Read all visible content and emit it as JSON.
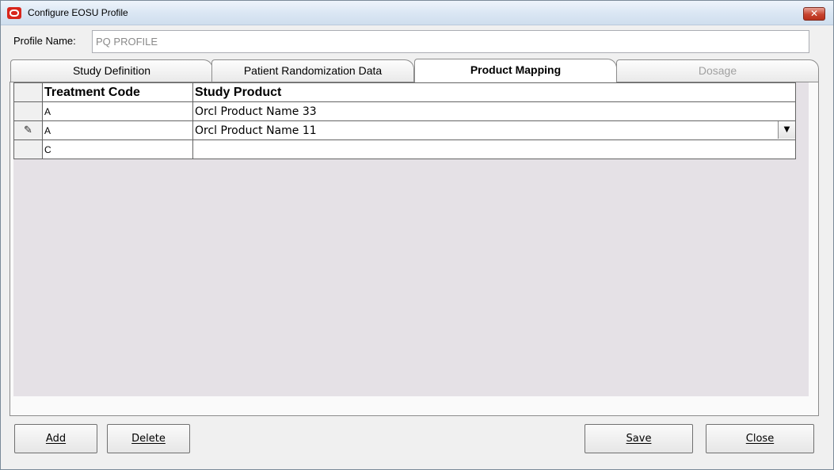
{
  "window": {
    "title": "Configure EOSU Profile",
    "close_glyph": "✕"
  },
  "profile": {
    "label": "Profile Name:",
    "value": "PQ PROFILE"
  },
  "tabs": [
    {
      "label": "Study Definition",
      "state": "normal"
    },
    {
      "label": "Patient Randomization Data",
      "state": "normal"
    },
    {
      "label": "Product Mapping",
      "state": "active"
    },
    {
      "label": "Dosage",
      "state": "disabled"
    }
  ],
  "grid": {
    "columns": [
      "Treatment Code",
      "Study Product"
    ],
    "rows": [
      {
        "treatment_code": "A",
        "study_product": "Orcl Product Name 33",
        "editing": false
      },
      {
        "treatment_code": "A",
        "study_product": "Orcl Product Name 11",
        "editing": true
      },
      {
        "treatment_code": "C",
        "study_product": "",
        "editing": false
      }
    ],
    "edit_indicator": "✎",
    "dropdown_glyph": "▼"
  },
  "buttons": {
    "add": {
      "label": "Add"
    },
    "delete": {
      "label": "Delete"
    },
    "save": {
      "label": "Save"
    },
    "close": {
      "label": "Close"
    }
  },
  "colors": {
    "accent_close": "#c7432f",
    "grid_background": "#e5e1e6",
    "disabled_text": "#a0a0a0"
  }
}
